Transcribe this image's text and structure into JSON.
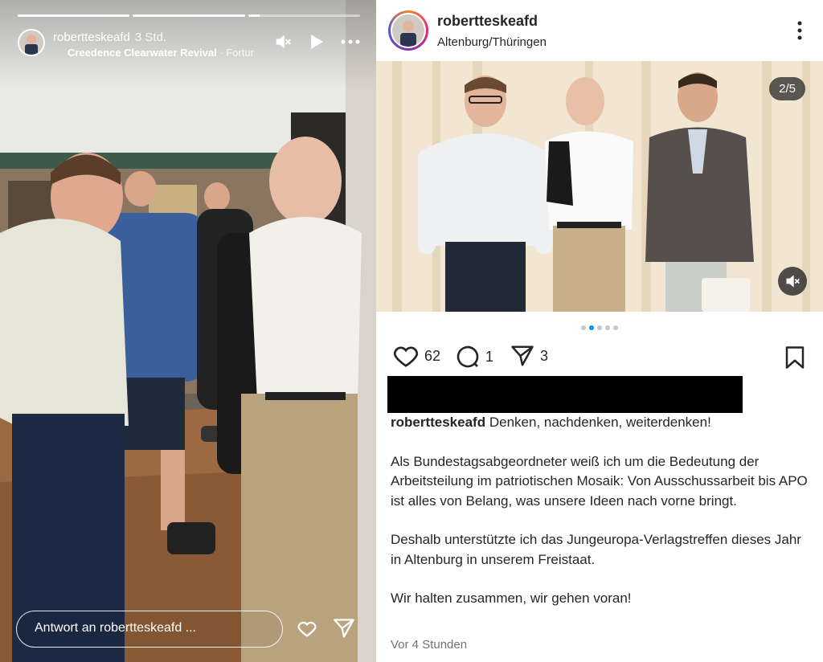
{
  "story": {
    "username": "robertteskeafd",
    "time": "3 Std.",
    "music_artist": "Creedence Clearwater Revival",
    "music_track": " · Fortur",
    "progress": [
      1.0,
      1.0,
      0.1
    ],
    "reply_placeholder": "Antwort an robertteskeafd ...",
    "icons": [
      "muted-speaker-icon",
      "play-icon",
      "more-horizontal-icon",
      "heart-icon",
      "send-icon"
    ]
  },
  "post": {
    "username": "robertteskeafd",
    "location": "Altenburg/Thüringen",
    "image_counter": "2/5",
    "carousel": {
      "total": 5,
      "active_index": 1
    },
    "likes": "62",
    "comments": "1",
    "shares": "3",
    "caption": {
      "user": "robertteskeafd",
      "first_line": "Denken, nachdenken, weiterdenken!",
      "paragraph_1": "Als Bundestagsabgeordneter weiß ich um die Bedeutung der Arbeitsteilung im patriotischen Mosaik: Von Ausschussarbeit bis APO ist alles von Belang, was unsere Ideen nach vorne bringt.",
      "paragraph_2": "Deshalb unterstützte ich das Jungeuropa-Verlagstreffen dieses Jahr in Altenburg in unserem Freistaat.",
      "paragraph_3": "Wir halten zusammen, wir gehen voran!"
    },
    "time_ago": "Vor 4 Stunden"
  },
  "colors": {
    "like_blue": "#0095f6",
    "text": "#262626",
    "muted": "#737373"
  }
}
